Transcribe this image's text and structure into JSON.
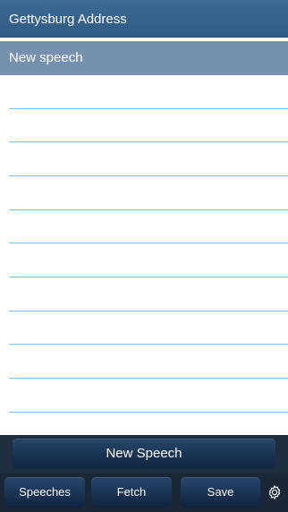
{
  "header": {
    "title": "Gettysburg Address"
  },
  "speech_list": {
    "items": [
      {
        "label": "New speech"
      }
    ]
  },
  "actions": {
    "new_speech_label": "New Speech"
  },
  "toolbar": {
    "speeches_label": "Speeches",
    "fetch_label": "Fetch",
    "save_label": "Save",
    "settings_icon": "gear-icon"
  },
  "colors": {
    "header_bg": "#2f5a84",
    "selected_row_bg": "#7691af",
    "rule_line": "#79c4ef",
    "toolbar_bg": "#1a2736",
    "button_bg": "#0f2440"
  }
}
